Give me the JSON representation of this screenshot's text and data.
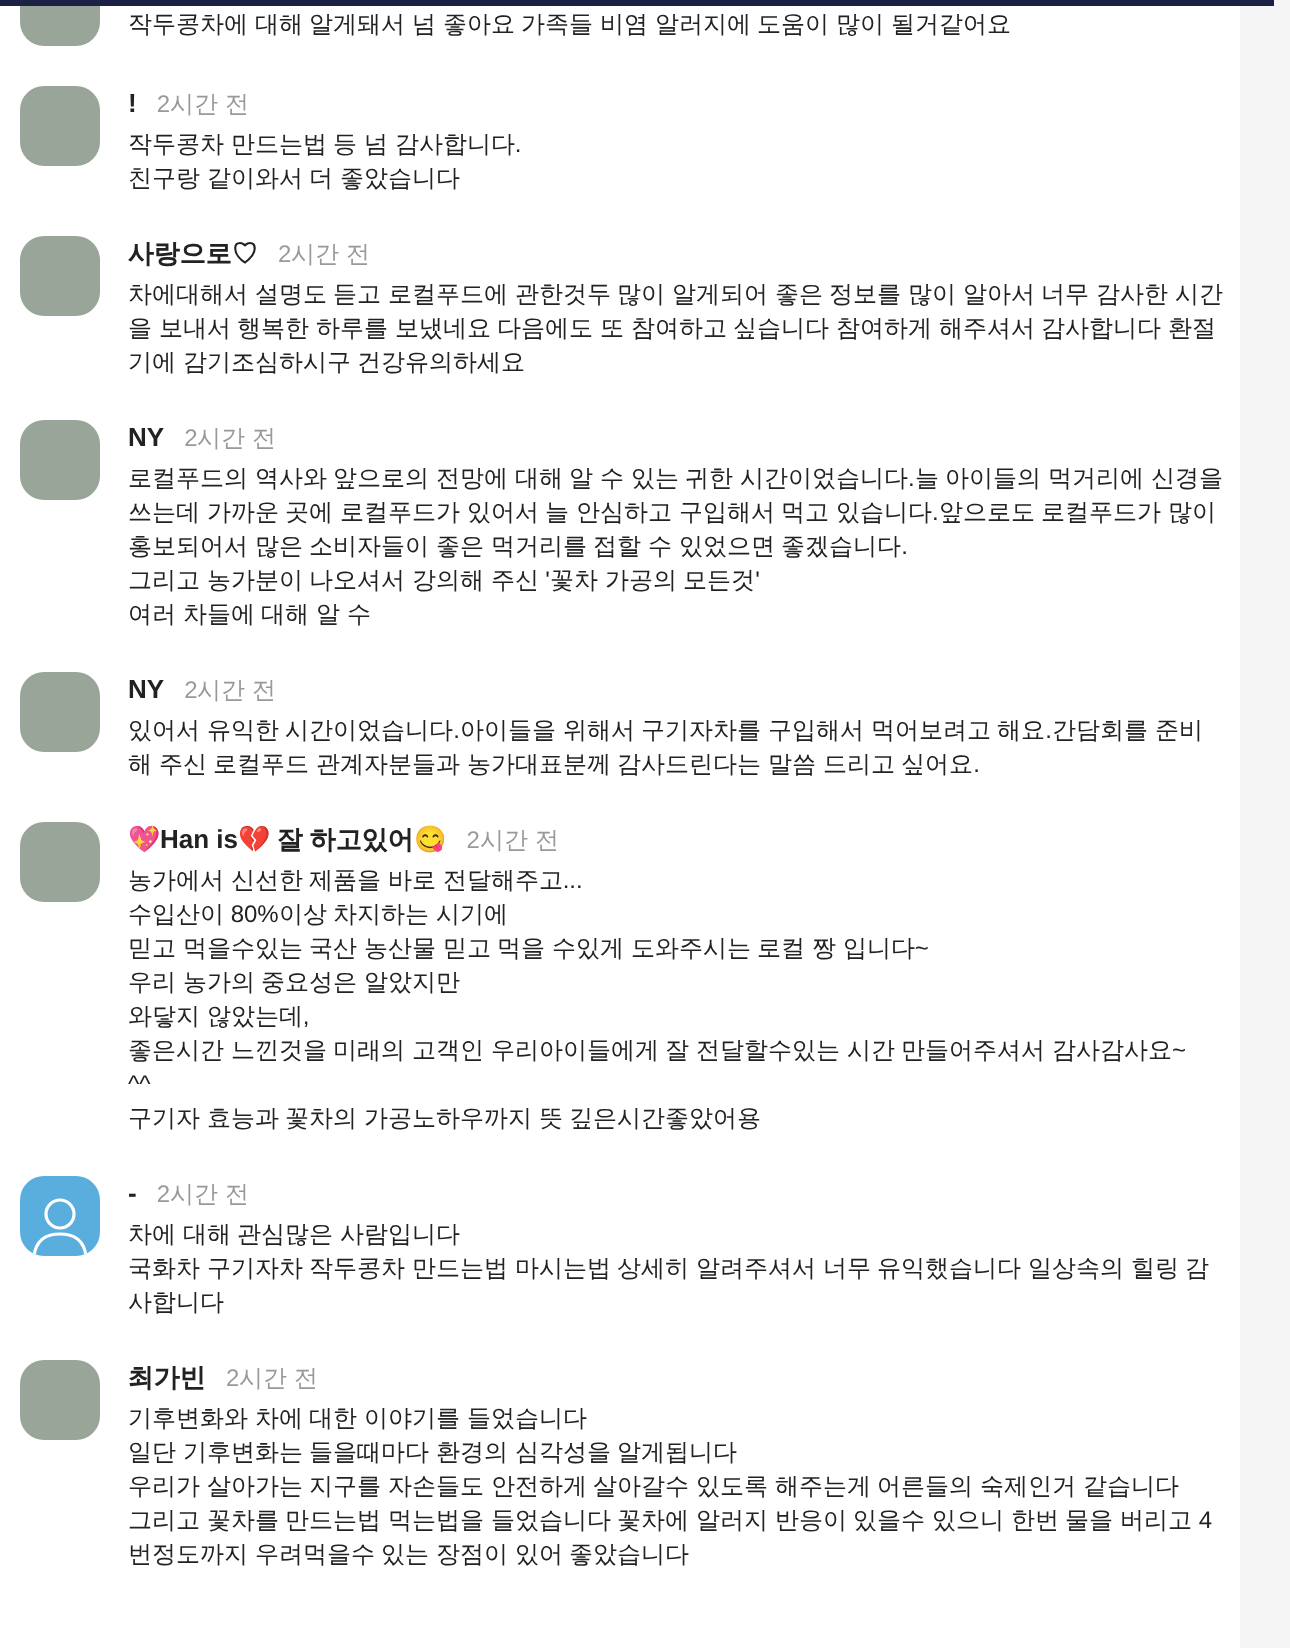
{
  "comments": [
    {
      "kind": "photo",
      "lines": [
        "작두콩차에 대해 알게돼서 넘 좋아요 가족들 비염 알러지에 도움이 많이 될거같어요"
      ]
    },
    {
      "author": "!",
      "time": "2시간 전",
      "kind": "photo",
      "lines": [
        "작두콩차 만드는법 등 넘 감사합니다.",
        "친구랑 같이와서 더 좋았습니다"
      ]
    },
    {
      "author": "사랑으로♡",
      "time": "2시간 전",
      "kind": "photo",
      "lines": [
        "차에대해서 설명도 듣고 로컬푸드에 관한것두 많이 알게되어 좋은 정보를 많이 알아서 너무 감사한 시간을 보내서 행복한 하루를 보냈네요 다음에도 또 참여하고 싶습니다 참여하게 해주셔서 감사합니다 환절기에 감기조심하시구 건강유의하세요"
      ]
    },
    {
      "author": "NY",
      "time": "2시간 전",
      "kind": "photo",
      "lines": [
        "로컬푸드의 역사와 앞으로의 전망에 대해 알 수 있는 귀한 시간이었습니다.늘 아이들의 먹거리에 신경을 쓰는데 가까운 곳에 로컬푸드가 있어서 늘 안심하고 구입해서 먹고 있습니다.앞으로도 로컬푸드가 많이 홍보되어서 많은 소비자들이 좋은 먹거리를 접할 수 있었으면 좋겠습니다.",
        "그리고 농가분이 나오셔서 강의해 주신 '꽃차 가공의 모든것'",
        "여러 차들에 대해 알 수"
      ]
    },
    {
      "author": "NY",
      "time": "2시간 전",
      "kind": "photo",
      "lines": [
        "있어서 유익한 시간이었습니다.아이들을 위해서 구기자차를 구입해서 먹어보려고 해요.간담회를 준비해 주신 로컬푸드 관계자분들과 농가대표분께 감사드린다는 말씀 드리고 싶어요."
      ]
    },
    {
      "author": "💖Han is💔 잘 하고있어😋",
      "time": "2시간 전",
      "kind": "photo",
      "lines": [
        "농가에서 신선한 제품을 바로 전달해주고...",
        "수입산이 80%이상 차지하는 시기에",
        "믿고 먹을수있는 국산 농산물 믿고 먹을 수있게 도와주시는 로컬 짱 입니다~",
        "우리 농가의 중요성은 알았지만",
        "와닿지 않았는데,",
        "좋은시간 느낀것을 미래의 고객인 우리아이들에게 잘 전달할수있는 시간 만들어주셔서 감사감사요~",
        "^^",
        "구기자 효능과 꽃차의 가공노하우까지 뜻 깊은시간좋았어용"
      ]
    },
    {
      "author": "-",
      "time": "2시간 전",
      "kind": "default",
      "lines": [
        "차에 대해 관심많은 사람입니다",
        "국화차 구기자차 작두콩차 만드는법 마시는법 상세히 알려주셔서 너무 유익했습니다 일상속의 힐링 감사합니다"
      ]
    },
    {
      "author": "최가빈",
      "time": "2시간 전",
      "kind": "photo",
      "lines": [
        "기후변화와 차에 대한 이야기를 들었습니다",
        "일단 기후변화는 들을때마다 환경의 심각성을 알게됩니다",
        "우리가 살아가는 지구를 자손들도 안전하게 살아갈수 있도록 해주는게 어른들의 숙제인거 같습니다",
        "그리고 꽃차를 만드는법 먹는법을 들었습니다 꽃차에 알러지 반응이 있을수 있으니 한번 물을 버리고 4번정도까지 우려먹을수 있는 장점이 있어 좋았습니다"
      ]
    }
  ]
}
